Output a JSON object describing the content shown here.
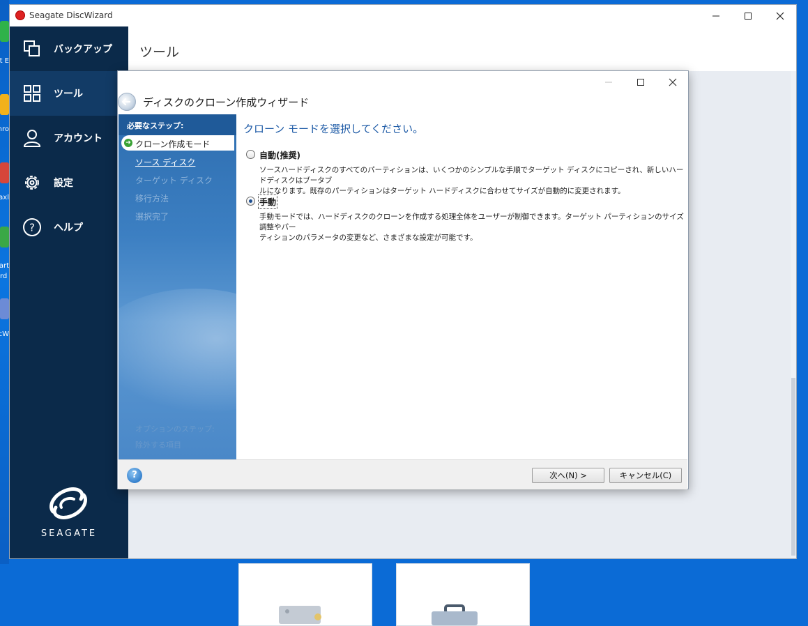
{
  "window": {
    "title": "Seagate DiscWizard"
  },
  "desktop_labels": [
    "t E",
    "hro",
    "axl",
    "art",
    "rd",
    "cW"
  ],
  "sidebar": {
    "items": [
      {
        "label": "バックアップ",
        "icon": "copy-icon"
      },
      {
        "label": "ツール",
        "icon": "grid-icon",
        "active": true
      },
      {
        "label": "アカウント",
        "icon": "person-icon"
      },
      {
        "label": "設定",
        "icon": "gear-icon"
      },
      {
        "label": "ヘルプ",
        "icon": "help-icon"
      }
    ],
    "brand": "SEAGATE"
  },
  "main": {
    "title": "ツール"
  },
  "wizard": {
    "title": "ディスクのクローン作成ウィザード",
    "steps_header": "必要なステップ:",
    "steps": [
      {
        "label": "クローン作成モード",
        "state": "current"
      },
      {
        "label": "ソース ディスク",
        "state": "link"
      },
      {
        "label": "ターゲット ディスク",
        "state": "disabled"
      },
      {
        "label": "移行方法",
        "state": "disabled"
      },
      {
        "label": "選択完了",
        "state": "disabled"
      }
    ],
    "optional_steps_header": "オプションのステップ:",
    "optional_steps": [
      "除外する項目"
    ],
    "heading": "クローン モードを選択してください。",
    "options": [
      {
        "label": "自動(推奨)",
        "checked": false,
        "desc1": "ソースハードディスクのすべてのパーティションは、いくつかのシンプルな手順でターゲット ディスクにコピーされ、新しいハードディスクはブータブ",
        "desc2": "ルになります。既存のパーティションはターゲット ハードディスクに合わせてサイズが自動的に変更されます。"
      },
      {
        "label": "手動",
        "checked": true,
        "desc1": "手動モードでは、ハードディスクのクローンを作成する処理全体をユーザーが制御できます。ターゲット パーティションのサイズ調整やパー",
        "desc2": "ティションのパラメータの変更など、さまざまな設定が可能です。"
      }
    ],
    "next_button": "次へ(N) >",
    "cancel_button": "キャンセル(C)",
    "help_glyph": "?"
  }
}
